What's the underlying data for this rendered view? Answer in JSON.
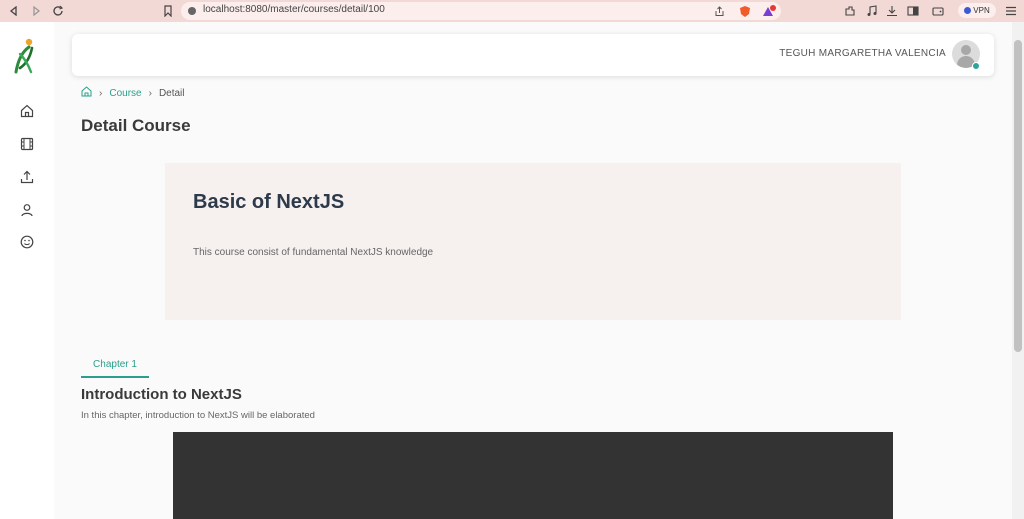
{
  "browser": {
    "url": "localhost:8080/master/courses/detail/100",
    "vpn_label": "VPN"
  },
  "header": {
    "user_name": "TEGUH MARGARETHA VALENCIA"
  },
  "breadcrumb": {
    "items": [
      "Course",
      "Detail"
    ]
  },
  "page": {
    "title": "Detail Course"
  },
  "course": {
    "title": "Basic of NextJS",
    "description": "This course consist of fundamental NextJS knowledge"
  },
  "chapter": {
    "tab_label": "Chapter 1",
    "title": "Introduction to NextJS",
    "description": "In this chapter, introduction to NextJS will be elaborated"
  },
  "colors": {
    "accent": "#2aa08c",
    "card_bg": "#f6f0ef",
    "browser_bar": "#f3d9d5"
  },
  "icons": {
    "sidebar": [
      "home-icon",
      "film-icon",
      "upload-icon",
      "user-icon",
      "smile-icon"
    ]
  }
}
